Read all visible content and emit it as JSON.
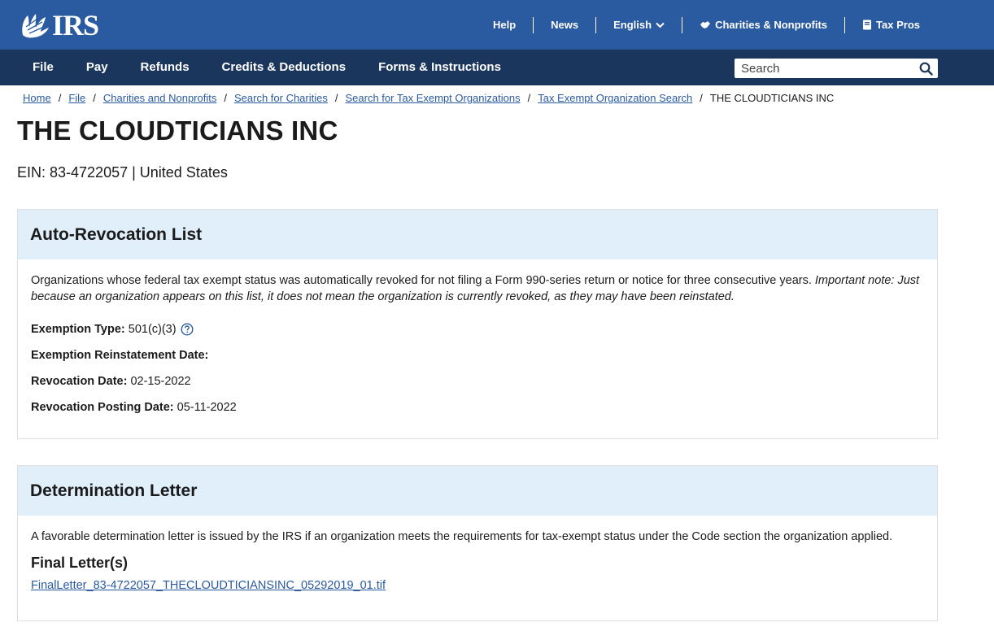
{
  "header": {
    "logo_text": "IRS",
    "util_nav": {
      "help": "Help",
      "news": "News",
      "language": "English",
      "charities": "Charities & Nonprofits",
      "tax_pros": "Tax Pros"
    }
  },
  "main_nav": {
    "items": [
      "File",
      "Pay",
      "Refunds",
      "Credits & Deductions",
      "Forms & Instructions"
    ],
    "search_placeholder": "Search"
  },
  "breadcrumb": {
    "links": [
      "Home",
      "File",
      "Charities and Nonprofits",
      "Search for Charities",
      "Search for Tax Exempt Organizations",
      "Tax Exempt Organization Search"
    ],
    "current": "THE CLOUDTICIANS INC"
  },
  "org": {
    "name": "THE CLOUDTICIANS INC",
    "ein_line": "EIN: 83-4722057 | United States"
  },
  "auto_revocation": {
    "title": "Auto-Revocation List",
    "intro": "Organizations whose federal tax exempt status was automatically revoked for not filing a Form 990-series return or notice for three consecutive years.",
    "note": "Important note: Just because an organization appears on this list, it does not mean the organization is currently revoked, as they may have been reinstated.",
    "fields": [
      {
        "label": "Exemption Type:",
        "value": "501(c)(3)"
      },
      {
        "label": "Exemption Reinstatement Date:",
        "value": ""
      },
      {
        "label": "Revocation Date:",
        "value": "02-15-2022"
      },
      {
        "label": "Revocation Posting Date:",
        "value": "05-11-2022"
      }
    ]
  },
  "determination": {
    "title": "Determination Letter",
    "intro": "A favorable determination letter is issued by the IRS if an organization meets the requirements for tax-exempt status under the Code section the organization applied.",
    "final_title": "Final Letter(s)",
    "file": "FinalLetter_83-4722057_THECLOUDTICIANSINC_05292019_01.tif"
  },
  "colors": {
    "header_blue": "#2a5aa0",
    "nav_navy": "#1b365d",
    "card_head": "#e1effa",
    "link": "#2a5aa0"
  }
}
